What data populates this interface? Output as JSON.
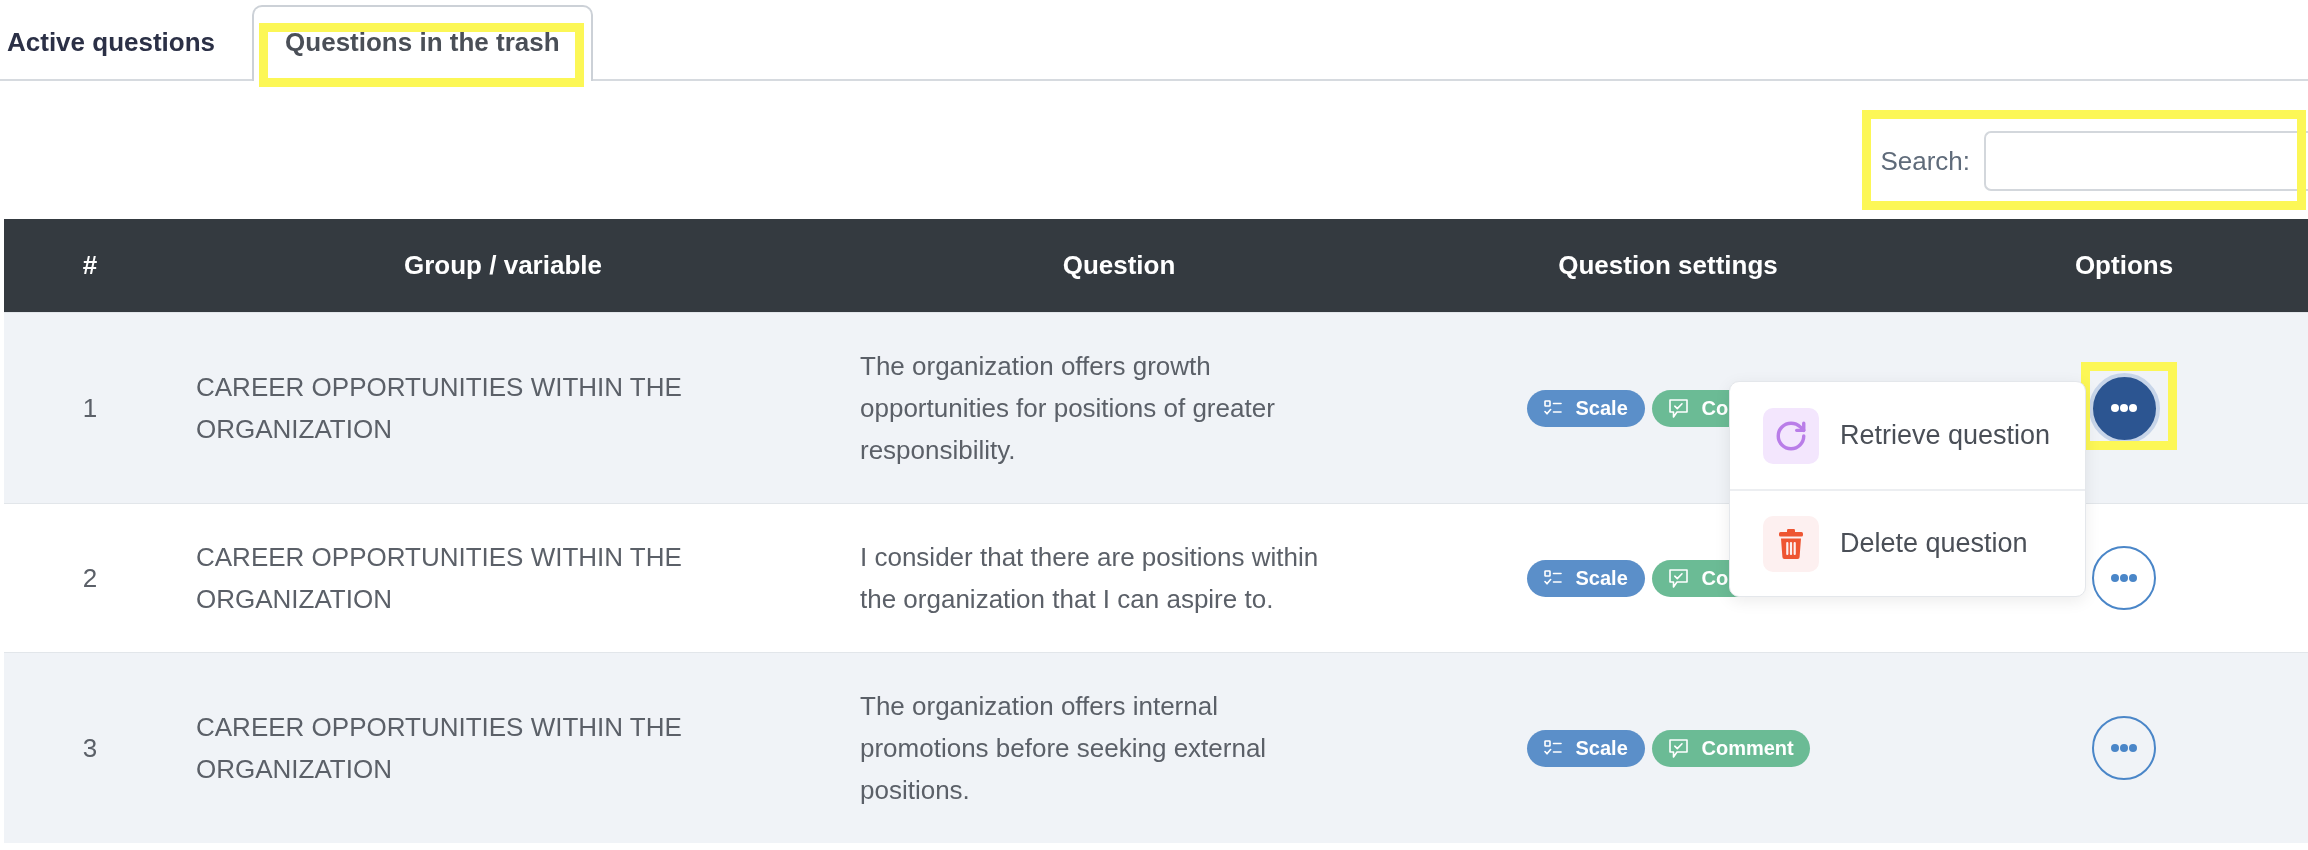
{
  "tabs": [
    {
      "label": "Active questions",
      "selected": false,
      "highlighted": false
    },
    {
      "label": "Questions in the trash",
      "selected": true,
      "highlighted": true
    }
  ],
  "search": {
    "label": "Search:",
    "highlighted": true
  },
  "table": {
    "columns": [
      "#",
      "Group / variable",
      "Question",
      "Question settings",
      "Options"
    ],
    "rows": [
      {
        "number": "1",
        "group": "CAREER OPPORTUNITIES WITHIN THE ORGANIZATION",
        "question": "The organization offers growth opportunities for positions of greater responsibility.",
        "settings": [
          {
            "kind": "scale",
            "label": "Scale"
          },
          {
            "kind": "comment",
            "label": "Co"
          }
        ],
        "options_button": {
          "active": true,
          "highlighted": true
        }
      },
      {
        "number": "2",
        "group": "CAREER OPPORTUNITIES WITHIN THE ORGANIZATION",
        "question": "I consider that there are positions within the organization that I can aspire to.",
        "settings": [
          {
            "kind": "scale",
            "label": "Scale"
          },
          {
            "kind": "comment",
            "label": "Co"
          }
        ],
        "options_button": {
          "active": false,
          "highlighted": false
        }
      },
      {
        "number": "3",
        "group": "CAREER OPPORTUNITIES WITHIN THE ORGANIZATION",
        "question": "The organization offers internal promotions before seeking external positions.",
        "settings": [
          {
            "kind": "scale",
            "label": "Scale"
          },
          {
            "kind": "comment",
            "label": "Comment"
          }
        ],
        "options_button": {
          "active": false,
          "highlighted": false
        }
      }
    ]
  },
  "options_menu": {
    "items": [
      {
        "kind": "retrieve",
        "label": "Retrieve question"
      },
      {
        "kind": "delete",
        "label": "Delete question"
      }
    ]
  }
}
